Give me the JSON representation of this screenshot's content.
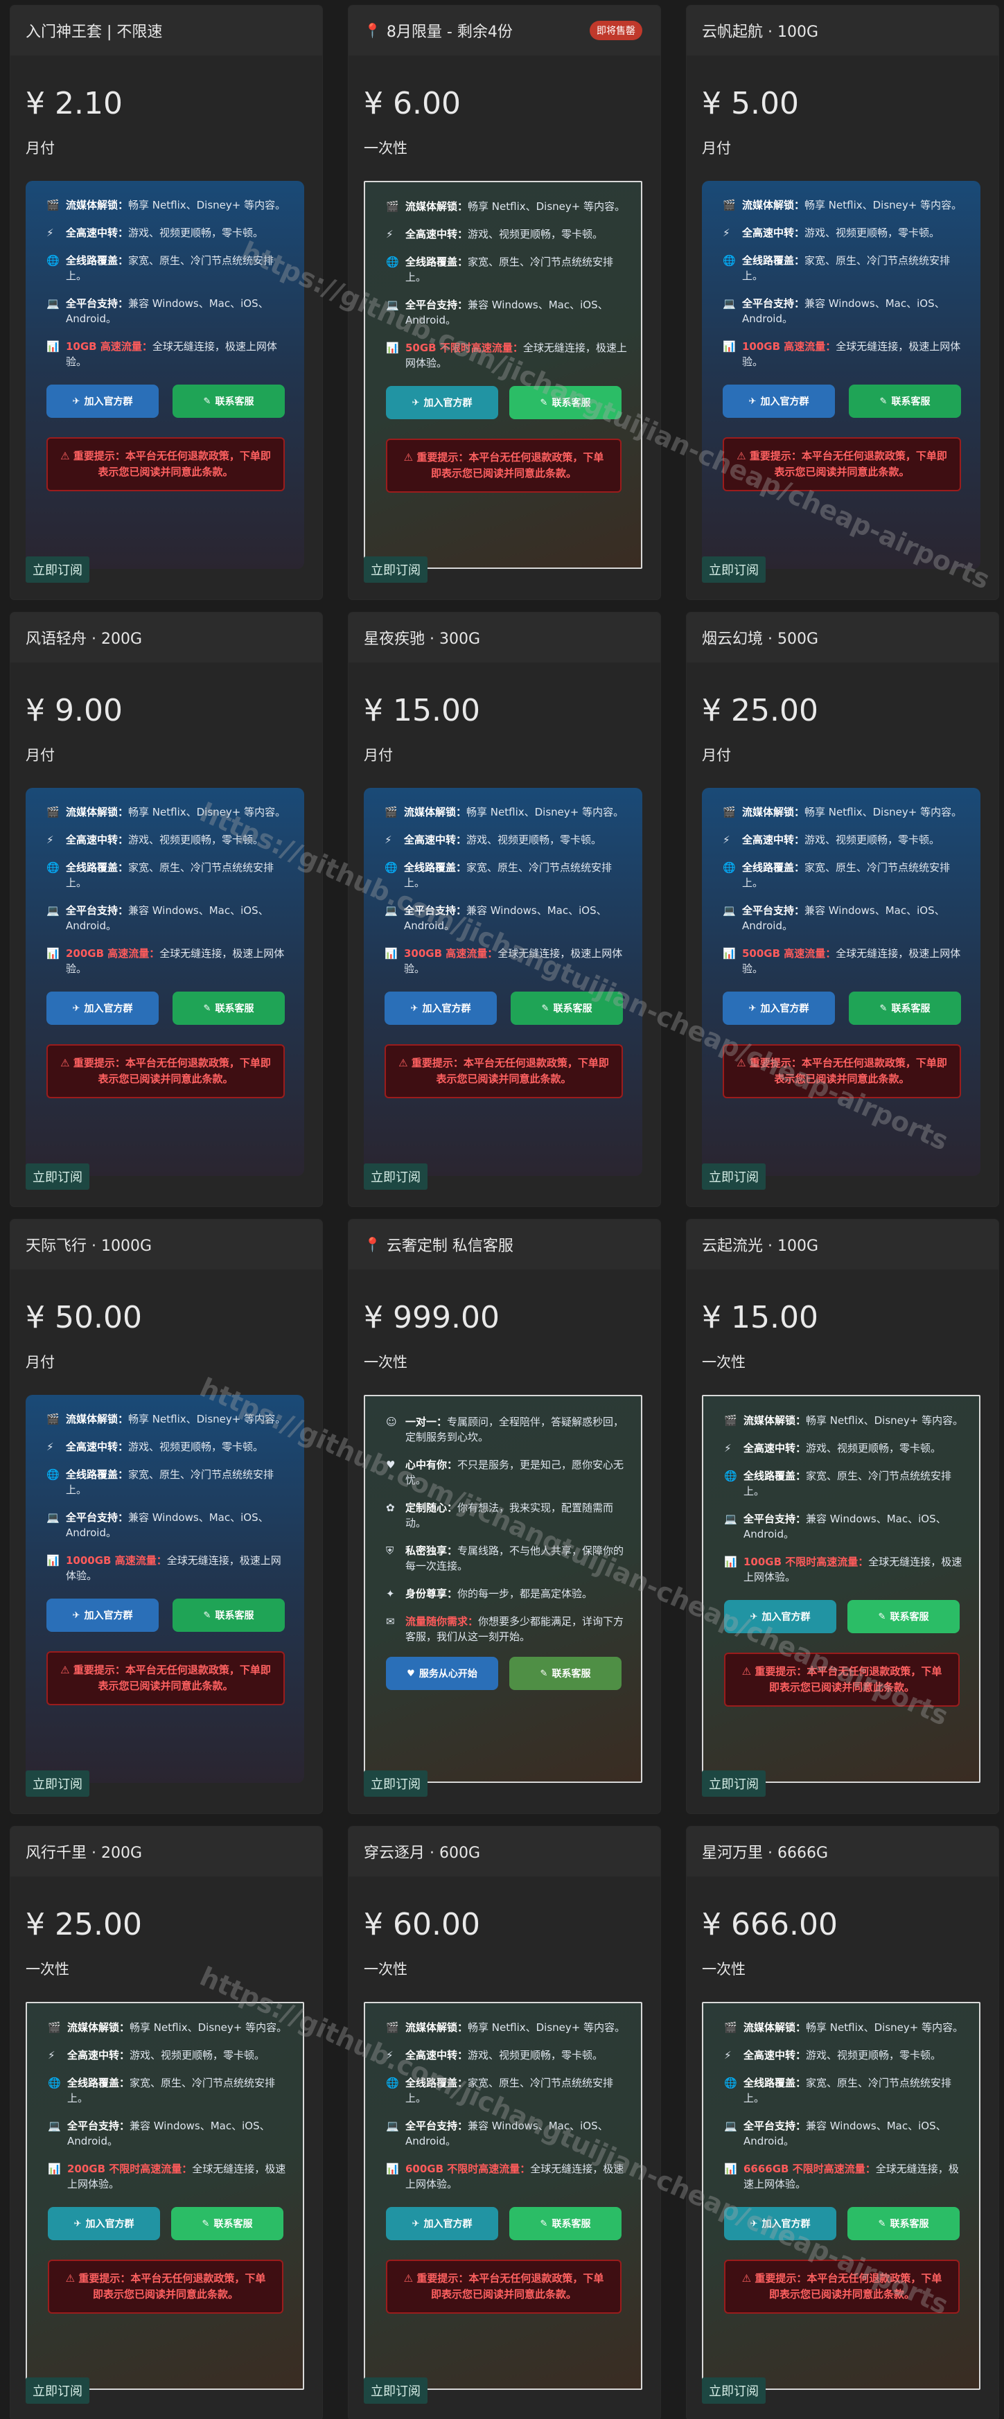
{
  "common": {
    "feature_labels": [
      "流媒体解锁：",
      "全高速中转：",
      "全线路覆盖：",
      "全平台支持："
    ],
    "feature_texts": [
      "畅享 Netflix、Disney+ 等内容。",
      "游戏、视频更顺畅，零卡顿。",
      "家宽、原生、冷门节点统统安排上。",
      "兼容 Windows、Mac、iOS、Android。"
    ],
    "feature_icons": [
      "film-icon",
      "bolt-icon",
      "globe-icon",
      "laptop-icon"
    ],
    "join_group": "加入官方群",
    "contact_service": "联系客服",
    "warning": "重要提示：本平台无任何退款政策，下单即表示您已阅读并同意此条款。",
    "subscribe": "立即订阅"
  },
  "custom_plan": {
    "features": [
      {
        "label": "一对一：",
        "text": "专属顾问，全程陪伴，答疑解惑秒回，定制服务到心坎。"
      },
      {
        "label": "心中有你：",
        "text": "不只是服务，更是知己，愿你安心无忧。"
      },
      {
        "label": "定制随心：",
        "text": "你有想法，我来实现，配置随需而动。"
      },
      {
        "label": "私密独享：",
        "text": "专属线路，不与他人共享，保障你的每一次连接。"
      },
      {
        "label": "身份尊享：",
        "text": "你的每一步，都是高定体验。"
      },
      {
        "label": "流量随你需求：",
        "text": "你想要多少都能满足，详询下方客服，我们从这一刻开始。"
      }
    ],
    "start_button": "服务从心开始"
  },
  "plans": [
    {
      "title": "入门神王套 | 不限速",
      "price": "¥ 2.10",
      "period": "月付",
      "traffic": "10GB 高速流量：",
      "traffic_text": "全球无缝连接，极速上网体验。",
      "style": "blue"
    },
    {
      "title": "8月限量 - 剩余4份",
      "badge": "即将售罄",
      "pin": true,
      "price": "¥ 6.00",
      "period": "一次性",
      "traffic": "50GB 不限时高速流量：",
      "traffic_text": "全球无缝连接，极速上网体验。",
      "style": "green"
    },
    {
      "title": "云帆起航 · 100G",
      "price": "¥ 5.00",
      "period": "月付",
      "traffic": "100GB 高速流量：",
      "traffic_text": "全球无缝连接，极速上网体验。",
      "style": "blue"
    },
    {
      "title": "风语轻舟 · 200G",
      "price": "¥ 9.00",
      "period": "月付",
      "traffic": "200GB 高速流量：",
      "traffic_text": "全球无缝连接，极速上网体验。",
      "style": "blue"
    },
    {
      "title": "星夜疾驰 · 300G",
      "price": "¥ 15.00",
      "period": "月付",
      "traffic": "300GB 高速流量：",
      "traffic_text": "全球无缝连接，极速上网体验。",
      "style": "blue"
    },
    {
      "title": "烟云幻境 · 500G",
      "price": "¥ 25.00",
      "period": "月付",
      "traffic": "500GB 高速流量：",
      "traffic_text": "全球无缝连接，极速上网体验。",
      "style": "blue"
    },
    {
      "title": "天际飞行 · 1000G",
      "price": "¥ 50.00",
      "period": "月付",
      "traffic": "1000GB 高速流量：",
      "traffic_text": "全球无缝连接，极速上网体验。",
      "style": "blue"
    },
    {
      "title": "云奢定制 私信客服",
      "pin": true,
      "price": "¥ 999.00",
      "period": "一次性",
      "style": "custom"
    },
    {
      "title": "云起流光 · 100G",
      "price": "¥ 15.00",
      "period": "一次性",
      "traffic": "100GB 不限时高速流量：",
      "traffic_text": "全球无缝连接，极速上网体验。",
      "style": "green"
    },
    {
      "title": "风行千里 · 200G",
      "price": "¥ 25.00",
      "period": "一次性",
      "traffic": "200GB 不限时高速流量：",
      "traffic_text": "全球无缝连接，极速上网体验。",
      "style": "green"
    },
    {
      "title": "穿云逐月 · 600G",
      "price": "¥ 60.00",
      "period": "一次性",
      "traffic": "600GB 不限时高速流量：",
      "traffic_text": "全球无缝连接，极速上网体验。",
      "style": "green"
    },
    {
      "title": "星河万里 · 6666G",
      "price": "¥ 666.00",
      "period": "一次性",
      "traffic": "6666GB 不限时高速流量：",
      "traffic_text": "全球无缝连接，极速上网体验。",
      "style": "green"
    }
  ],
  "watermark": "https://github.com/jichangtuijian-cheap/cheap-airports"
}
